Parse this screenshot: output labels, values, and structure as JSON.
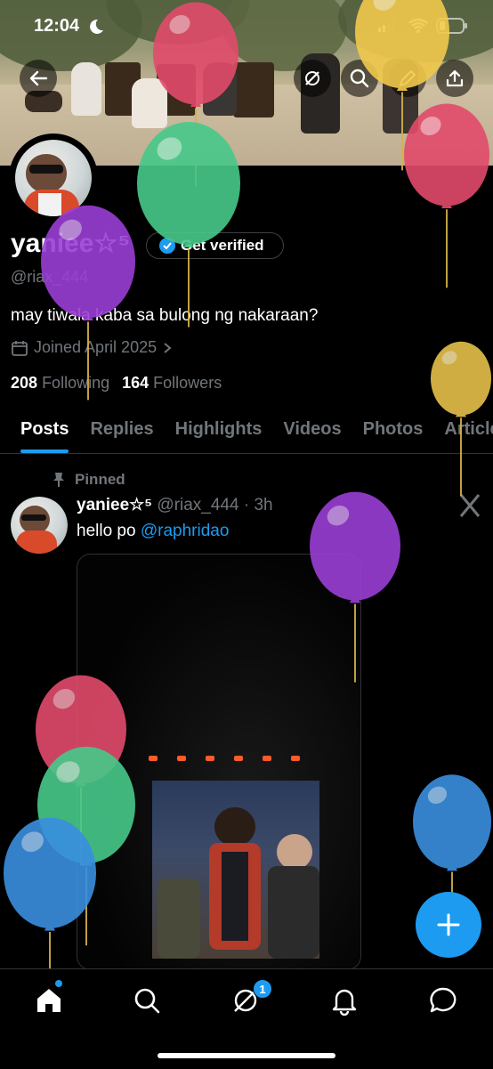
{
  "status_bar": {
    "time": "12:04"
  },
  "profile": {
    "display_name": "yaniee☆⁵",
    "verify_label": "Get verified",
    "handle": "@riax_444",
    "bio": "may tiwala kaba sa bulong ng nakaraan?",
    "joined": "Joined April 2025",
    "following_count": "208",
    "following_label": "Following",
    "followers_count": "164",
    "followers_label": "Followers"
  },
  "tabs": [
    {
      "label": "Posts",
      "active": true
    },
    {
      "label": "Replies"
    },
    {
      "label": "Highlights"
    },
    {
      "label": "Videos"
    },
    {
      "label": "Photos"
    },
    {
      "label": "Articles"
    }
  ],
  "pinned_post": {
    "pinned_label": "Pinned",
    "author_name": "yaniee☆⁵",
    "author_handle": "@riax_444",
    "time": "3h",
    "text_prefix": "hello po ",
    "mention": "@raphridao"
  },
  "bottom_nav": {
    "messages_badge": "1"
  },
  "colors": {
    "accent": "#1d9bf0",
    "background": "#000000",
    "muted": "#71767b"
  },
  "icons": [
    "back-arrow-icon",
    "grok-icon",
    "search-icon",
    "edit-icon",
    "share-icon",
    "calendar-icon",
    "chevron-right-icon",
    "pin-icon",
    "plus-icon",
    "home-icon",
    "spaces-icon",
    "bell-icon",
    "chat-icon"
  ]
}
